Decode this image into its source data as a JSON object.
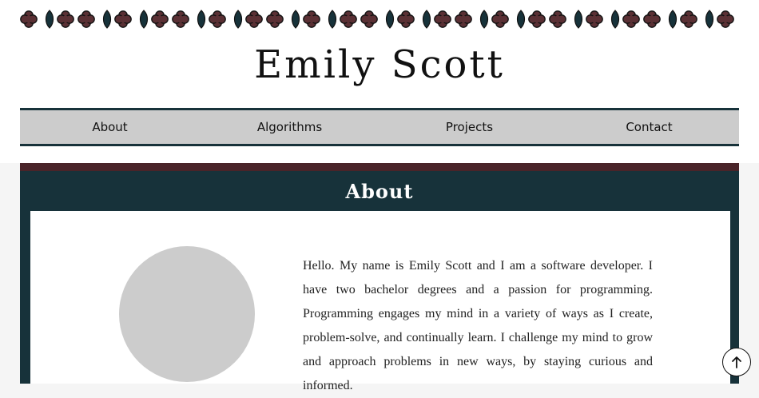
{
  "header": {
    "site_title": "Emily Scott"
  },
  "nav": {
    "items": [
      {
        "label": "About"
      },
      {
        "label": "Algorithms"
      },
      {
        "label": "Projects"
      },
      {
        "label": "Contact"
      }
    ]
  },
  "about": {
    "heading": "About",
    "bio": "Hello. My name is Emily Scott and I am a software developer. I have two bachelor degrees and a passion for programming. Programming engages my mind in a variety of ways as I create, problem-solve, and continually learn. I challenge my mind to grow and approach problems in new ways, by staying curious and informed."
  },
  "colors": {
    "teal_dark": "#17323a",
    "maroon": "#4a2429",
    "flower": "#5a3034",
    "nav_gray": "#cccccc"
  },
  "icons": {
    "ornament": "flower-leaf-border",
    "scroll_top": "arrow-up-icon"
  }
}
